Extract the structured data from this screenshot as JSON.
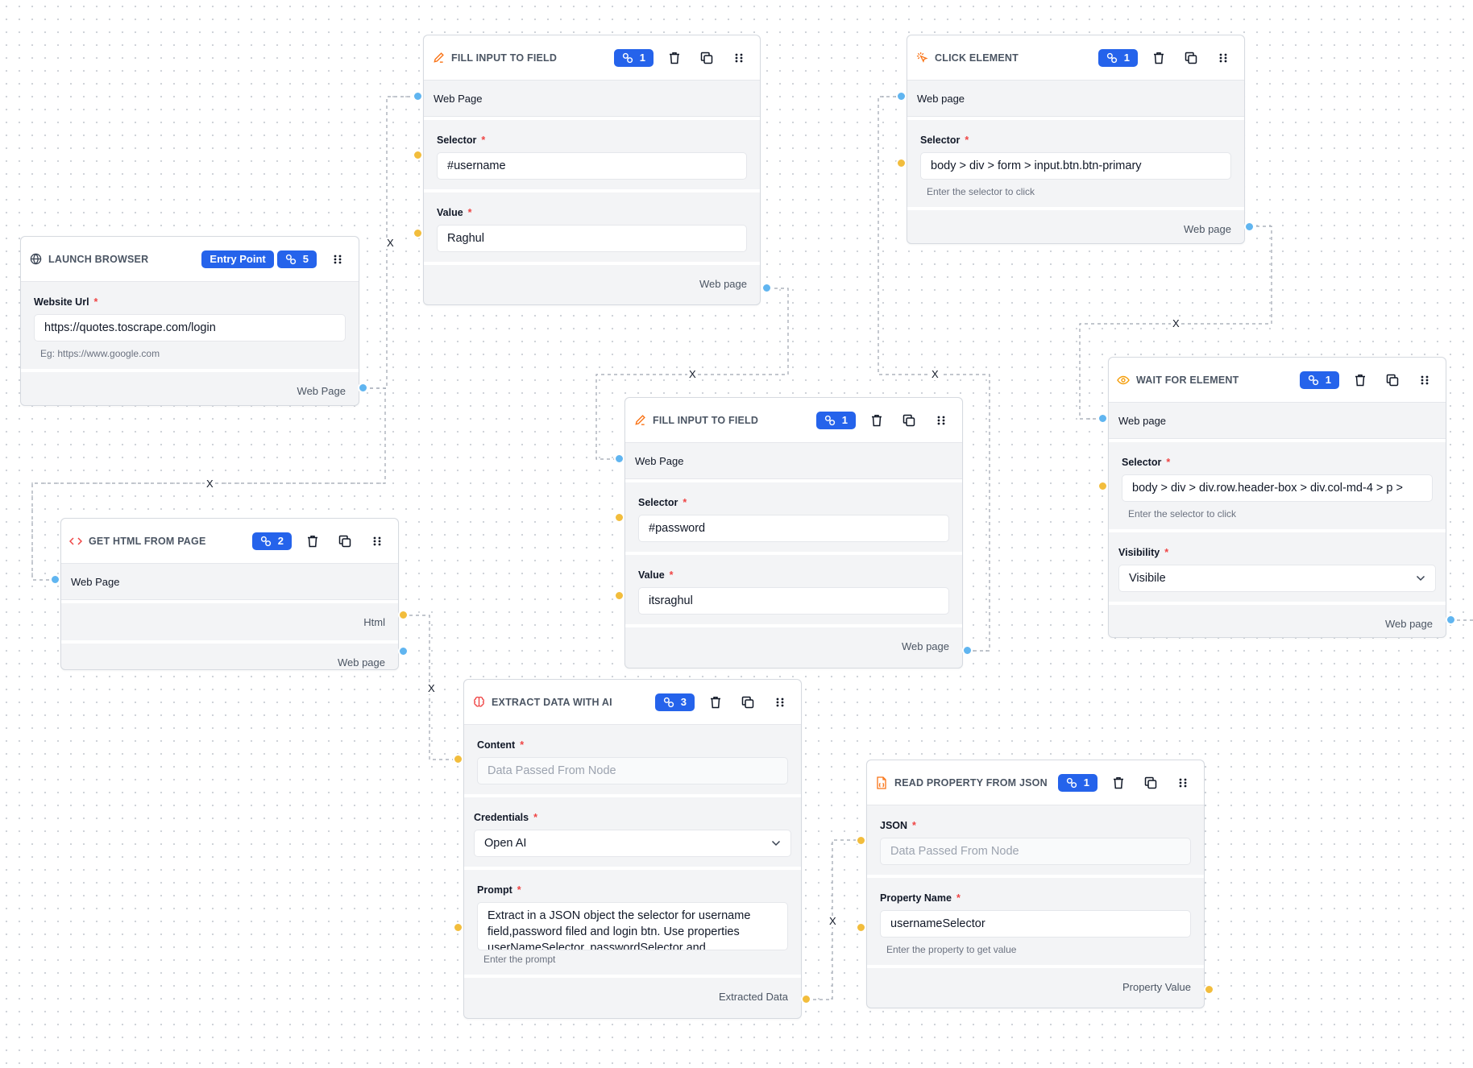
{
  "colors": {
    "accent": "#2563eb",
    "handle_blue": "#60b5f0",
    "handle_yellow": "#f2bd3c",
    "required": "#ef4444"
  },
  "edge_label": "X",
  "nodes": {
    "launch": {
      "icon": "globe-icon",
      "title": "LAUNCH BROWSER",
      "entry_label": "Entry Point",
      "badge": "5",
      "field_label": "Website Url",
      "field_value": "https://quotes.toscrape.com/login",
      "helper": "Eg: https://www.google.com",
      "output": "Web Page"
    },
    "fill1": {
      "icon": "pencil-icon",
      "title": "FILL INPUT TO FIELD",
      "badge": "1",
      "input": "Web Page",
      "selector_label": "Selector",
      "selector_value": "#username",
      "value_label": "Value",
      "value_value": "Raghul",
      "output": "Web page"
    },
    "click": {
      "icon": "click-icon",
      "title": "CLICK ELEMENT",
      "badge": "1",
      "input": "Web page",
      "selector_label": "Selector",
      "selector_value": "body > div > form > input.btn.btn-primary",
      "helper": "Enter the selector to click",
      "output": "Web page"
    },
    "wait": {
      "icon": "eye-icon",
      "title": "WAIT FOR ELEMENT",
      "badge": "1",
      "input": "Web page",
      "selector_label": "Selector",
      "selector_value": "body > div > div.row.header-box > div.col-md-4 > p >",
      "helper": "Enter the selector to click",
      "visibility_label": "Visibility",
      "visibility_value": "Visibile",
      "output": "Web page"
    },
    "fill2": {
      "icon": "pencil-icon",
      "title": "FILL INPUT TO FIELD",
      "badge": "1",
      "input": "Web Page",
      "selector_label": "Selector",
      "selector_value": "#password",
      "value_label": "Value",
      "value_value": "itsraghul",
      "output": "Web page"
    },
    "gethtml": {
      "icon": "code-icon",
      "title": "GET HTML FROM PAGE",
      "badge": "2",
      "input": "Web Page",
      "output_html": "Html",
      "output": "Web page"
    },
    "extract": {
      "icon": "brain-icon",
      "title": "EXTRACT DATA WITH AI",
      "badge": "3",
      "content_label": "Content",
      "content_placeholder": "Data Passed From Node",
      "cred_label": "Credentials",
      "cred_value": "Open AI",
      "prompt_label": "Prompt",
      "prompt_value": "Extract in a JSON object the selector for username field,password filed and login btn. Use properties userNameSelector, passwordSelector and",
      "helper": "Enter the prompt",
      "output": "Extracted Data"
    },
    "readjson": {
      "icon": "file-json-icon",
      "title": "READ PROPERTY FROM JSON",
      "badge": "1",
      "json_label": "JSON",
      "json_placeholder": "Data Passed From Node",
      "prop_label": "Property Name",
      "prop_value": "usernameSelector",
      "helper": "Enter the property to get value",
      "output": "Property Value"
    }
  }
}
